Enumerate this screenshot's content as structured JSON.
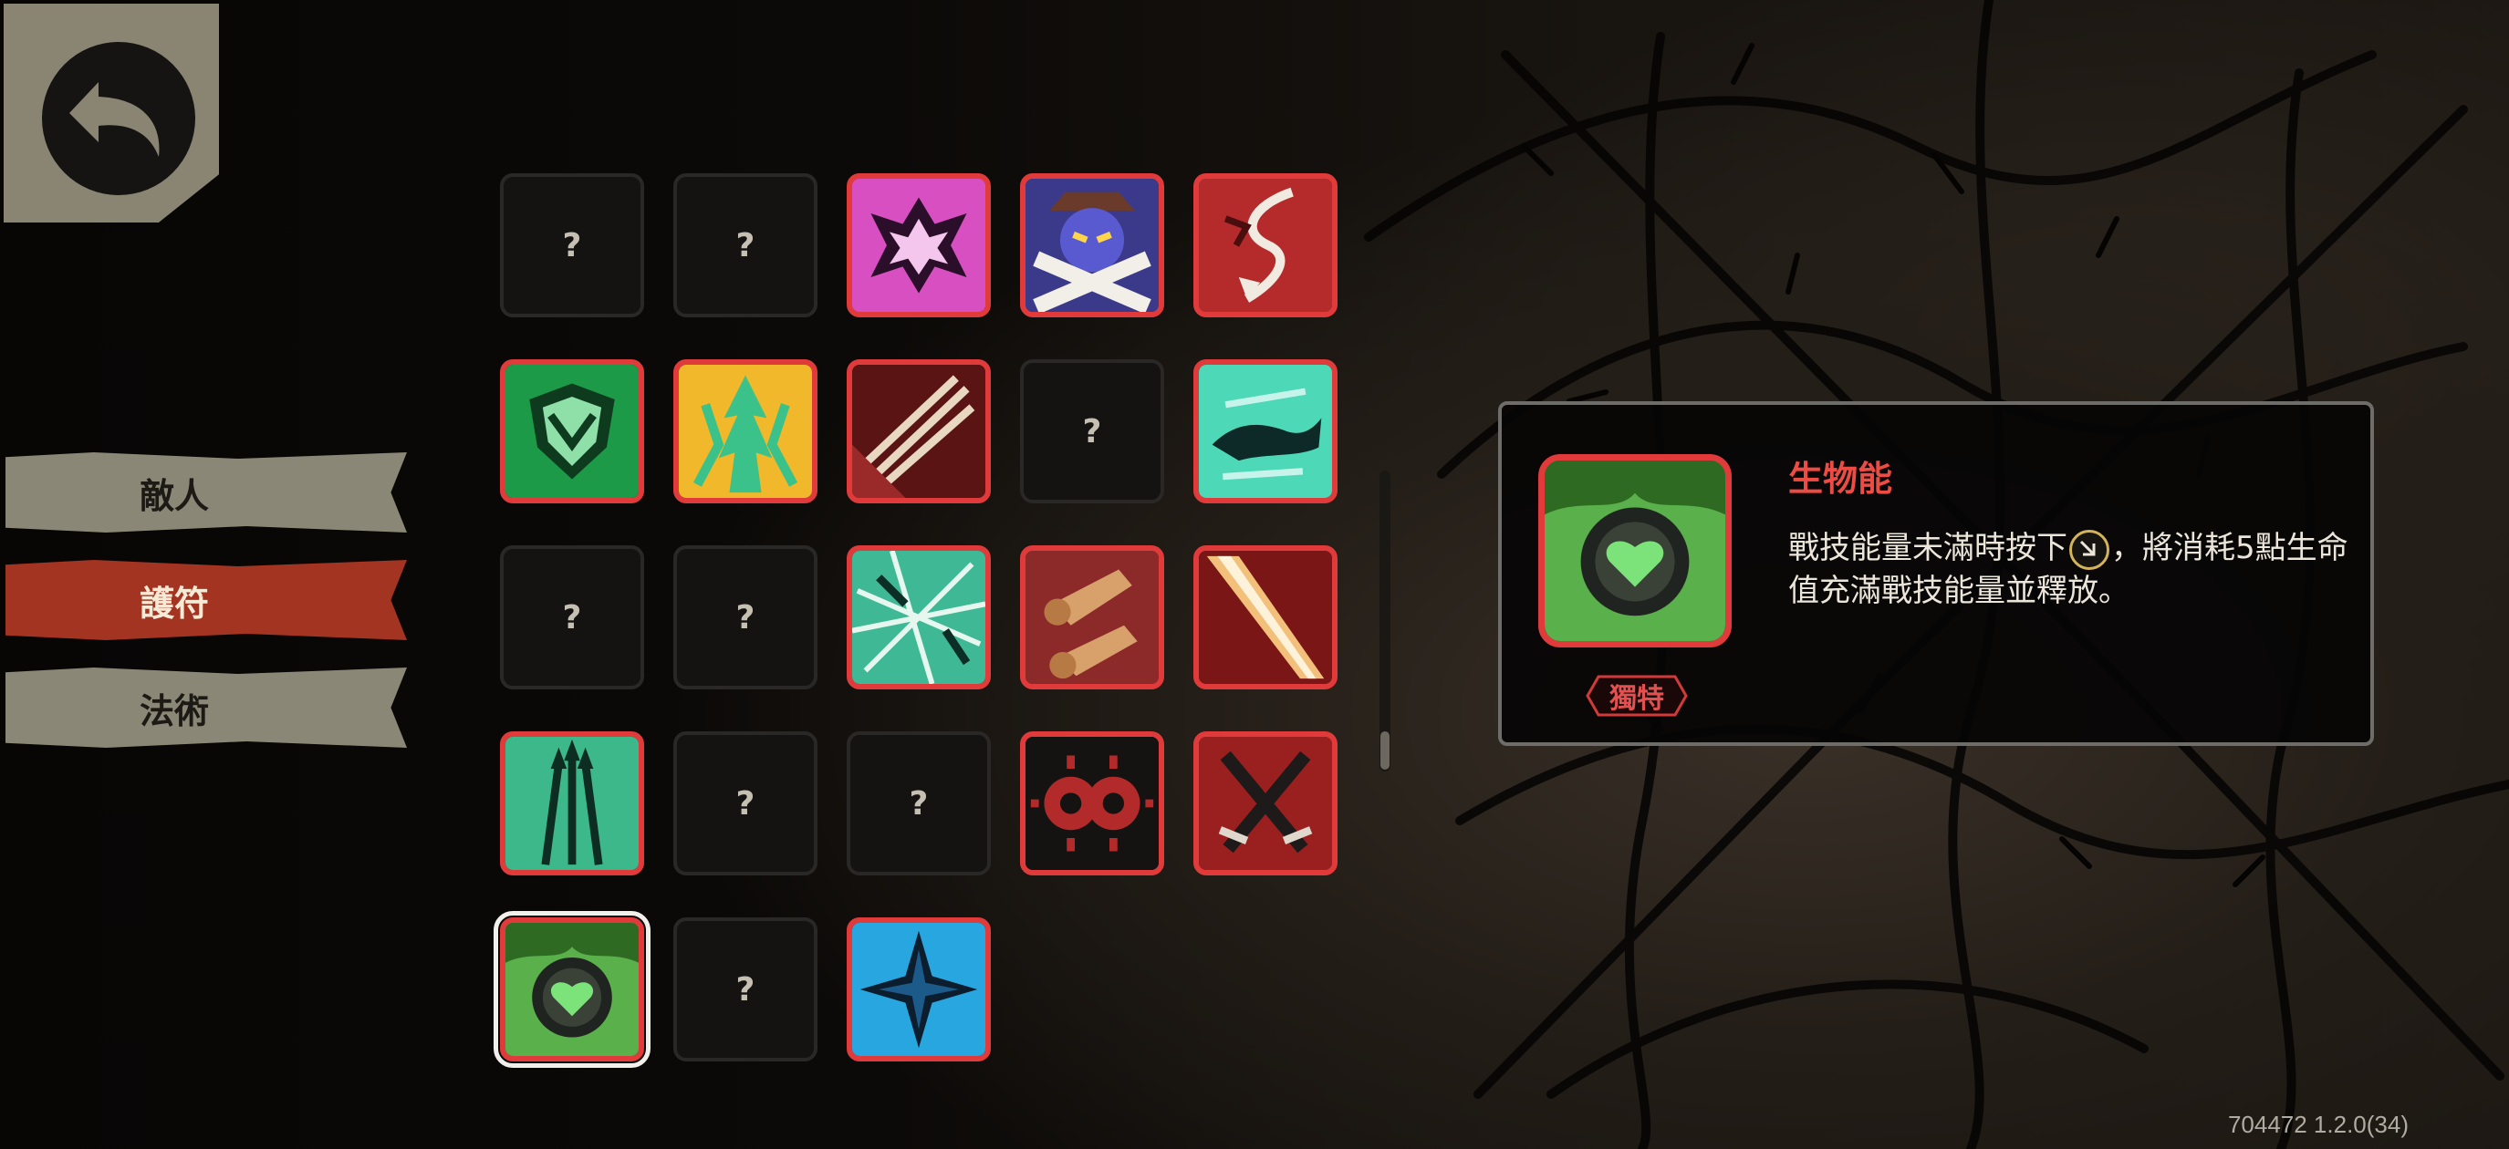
{
  "nav": {
    "back_icon": "back-arrow-icon",
    "tabs": [
      {
        "label": "敵人",
        "active": false
      },
      {
        "label": "護符",
        "active": true
      },
      {
        "label": "法術",
        "active": false
      }
    ]
  },
  "grid": {
    "locked_symbol": "?",
    "cells": [
      {
        "state": "locked"
      },
      {
        "state": "locked"
      },
      {
        "state": "unlocked",
        "icon": "pink-crest-icon"
      },
      {
        "state": "unlocked",
        "icon": "purple-demon-icon"
      },
      {
        "state": "unlocked",
        "icon": "red-lightning-icon"
      },
      {
        "state": "unlocked",
        "icon": "green-shield-icon"
      },
      {
        "state": "unlocked",
        "icon": "golden-arrows-icon"
      },
      {
        "state": "unlocked",
        "icon": "claw-slash-icon"
      },
      {
        "state": "locked"
      },
      {
        "state": "unlocked",
        "icon": "teal-dragon-icon"
      },
      {
        "state": "locked"
      },
      {
        "state": "locked"
      },
      {
        "state": "unlocked",
        "icon": "teal-cracks-icon"
      },
      {
        "state": "unlocked",
        "icon": "fists-icon"
      },
      {
        "state": "unlocked",
        "icon": "light-beam-icon"
      },
      {
        "state": "unlocked",
        "icon": "triple-spear-icon"
      },
      {
        "state": "locked"
      },
      {
        "state": "locked"
      },
      {
        "state": "unlocked",
        "icon": "spiked-rings-icon"
      },
      {
        "state": "unlocked",
        "icon": "crossed-swords-icon"
      },
      {
        "state": "unlocked",
        "icon": "bio-heart-icon",
        "selected": true
      },
      {
        "state": "locked"
      },
      {
        "state": "unlocked",
        "icon": "blue-star-icon"
      }
    ]
  },
  "detail": {
    "title": "生物能",
    "desc_part1": "戰技能量未滿時按下",
    "desc_part2": "，將消耗5點生命值充滿戰技能量並釋放。",
    "inline_icon": "dash-skill-icon",
    "rarity": "獨特",
    "icon": "bio-heart-icon"
  },
  "version": "704472 1.2.0(34)",
  "colors": {
    "accent_red": "#e13a3a",
    "title_red": "#ec4c44",
    "tab_active": "#a23421",
    "tab_inactive": "#8b8776"
  }
}
